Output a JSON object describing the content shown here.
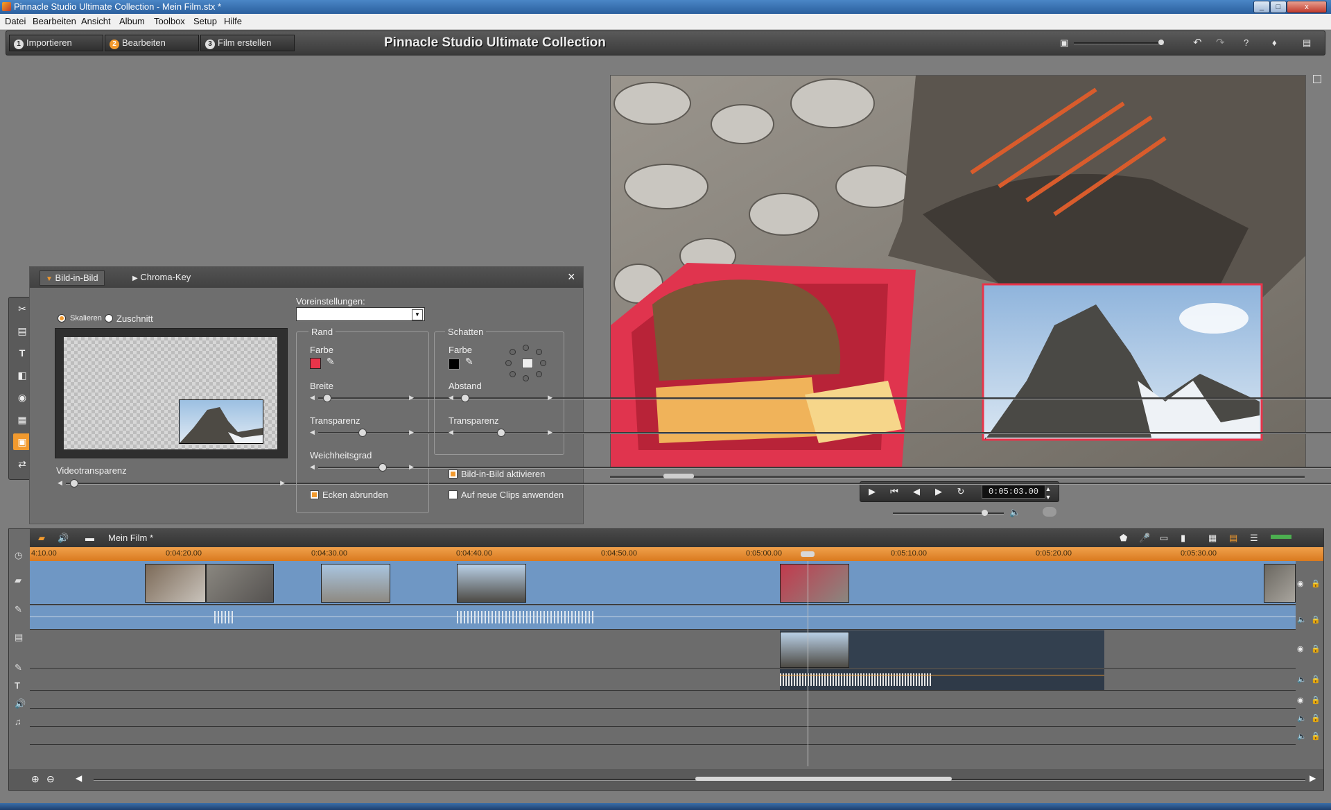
{
  "window": {
    "title": "Pinnacle Studio Ultimate Collection - Mein Film.stx *",
    "min_label": "_",
    "max_label": "□",
    "close_label": "x"
  },
  "menu": [
    "Datei",
    "Bearbeiten",
    "Ansicht",
    "Album",
    "Toolbox",
    "Setup",
    "Hilfe"
  ],
  "app": {
    "title": "Pinnacle Studio Ultimate Collection",
    "modes": [
      {
        "num": "1",
        "label": "Importieren"
      },
      {
        "num": "2",
        "label": "Bearbeiten"
      },
      {
        "num": "3",
        "label": "Film erstellen"
      }
    ],
    "header_icons": [
      "preview-size-icon",
      "undo-icon",
      "redo-icon",
      "help-icon",
      "hint-icon",
      "toolbox-icon"
    ]
  },
  "fx_panel": {
    "tabs": [
      "Bild-in-Bild",
      "Chroma-Key"
    ],
    "close": "×",
    "mode_scale": "Skalieren",
    "mode_crop": "Zuschnitt",
    "video_transparency": "Videotransparenz",
    "presets_label": "Voreinstellungen:",
    "presets_value": "",
    "border_group": "Rand",
    "border_color_label": "Farbe",
    "border_color": "#e8344a",
    "border_width_label": "Breite",
    "border_transparency_label": "Transparenz",
    "border_softness_label": "Weichheitsgrad",
    "round_corners": "Ecken abrunden",
    "shadow_group": "Schatten",
    "shadow_color_label": "Farbe",
    "shadow_color": "#000000",
    "shadow_distance_label": "Abstand",
    "shadow_transparency_label": "Transparenz",
    "enable_pip": "Bild-in-Bild aktivieren",
    "apply_new_clips": "Auf neue Clips anwenden",
    "slider_values": {
      "video_transparency": 0.02,
      "border_width": 0.06,
      "border_transparency": 0.5,
      "border_softness": 0.75,
      "shadow_distance": 0.05,
      "shadow_transparency": 0.5
    }
  },
  "tools": [
    "scissors-icon",
    "clip-props-icon",
    "title-icon",
    "transitions-icon",
    "camera-icon",
    "clapper-icon",
    "pip-icon",
    "speed-icon"
  ],
  "player": {
    "timecode": "0:05:03.00",
    "volume": 0.85,
    "scrub": 0.08
  },
  "timeline": {
    "project_name": "Mein Film *",
    "ticks": [
      "4:10.00",
      "0:04:20.00",
      "0:04:30.00",
      "0:04:40.00",
      "0:04:50.00",
      "0:05:00.00",
      "0:05:10.00",
      "0:05:20.00",
      "0:05:30.00"
    ],
    "scroll": 0.63
  }
}
